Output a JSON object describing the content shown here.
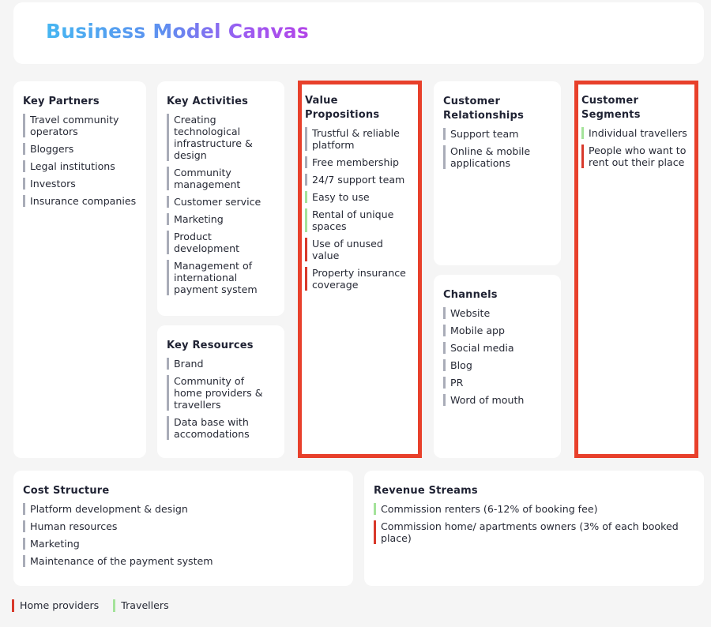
{
  "header": {
    "title": "Business Model Canvas"
  },
  "key_partners": {
    "title": "Key Partners",
    "items": [
      "Travel community operators",
      "Bloggers",
      "Legal institutions",
      "Investors",
      "Insurance companies"
    ]
  },
  "key_activities": {
    "title": "Key Activities",
    "items": [
      "Creating technological infrastructure & design",
      "Community management",
      "Customer service",
      "Marketing",
      "Product development",
      "Management of international payment system"
    ]
  },
  "key_resources": {
    "title": "Key Resources",
    "items": [
      "Brand",
      "Community of home providers & travellers",
      "Data base with accomodations"
    ]
  },
  "value_propositions": {
    "title": "Value Propositions",
    "items": [
      "Trustful & reliable platform",
      "Free membership",
      "24/7 support team",
      "Easy to use",
      "Rental of unique spaces",
      "Use of unused value",
      "Property insurance coverage"
    ]
  },
  "customer_relationships": {
    "title": "Customer Relationships",
    "items": [
      "Support team",
      "Online & mobile applications"
    ]
  },
  "channels": {
    "title": "Channels",
    "items": [
      "Website",
      "Mobile app",
      "Social media",
      "Blog",
      "PR",
      "Word of mouth"
    ]
  },
  "customer_segments": {
    "title": "Customer Segments",
    "items": [
      "Individual travellers",
      "People who want to rent out their place"
    ]
  },
  "cost_structure": {
    "title": "Cost Structure",
    "items": [
      "Platform development & design",
      "Human resources",
      "Marketing",
      "Maintenance of the payment system"
    ]
  },
  "revenue_streams": {
    "title": "Revenue Streams",
    "items": [
      "Commission renters (6-12% of booking fee)",
      "Commission home/ apartments owners (3% of each booked place)"
    ]
  },
  "legend": {
    "home_providers": "Home providers",
    "travellers": "Travellers"
  },
  "colors": {
    "highlight_border": "#e8402b",
    "home_providers": "#d8392b",
    "travellers": "#a4e39a",
    "neutral_bullet": "#a9acb8",
    "title_gradient": [
      "#46b6f1",
      "#9c5cf1",
      "#b344e8"
    ]
  }
}
